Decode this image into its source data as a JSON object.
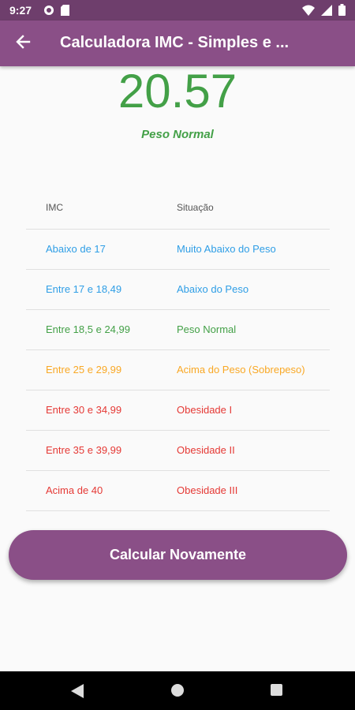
{
  "status_bar": {
    "time": "9:27"
  },
  "app_bar": {
    "title": "Calculadora IMC - Simples e ..."
  },
  "result": {
    "value": "20.57",
    "label": "Peso Normal"
  },
  "table": {
    "headers": [
      "IMC",
      "Situação"
    ],
    "rows": [
      {
        "imc": "Abaixo de 17",
        "situacao": "Muito Abaixo do Peso",
        "color": "#2f9ee6"
      },
      {
        "imc": "Entre 17 e 18,49",
        "situacao": "Abaixo do Peso",
        "color": "#2f9ee6"
      },
      {
        "imc": "Entre 18,5 e 24,99",
        "situacao": "Peso Normal",
        "color": "#43a047"
      },
      {
        "imc": "Entre 25 e 29,99",
        "situacao": "Acima do Peso (Sobrepeso)",
        "color": "#f9a825"
      },
      {
        "imc": "Entre 30 e 34,99",
        "situacao": "Obesidade I",
        "color": "#e53935"
      },
      {
        "imc": "Entre 35 e 39,99",
        "situacao": "Obesidade II",
        "color": "#e53935"
      },
      {
        "imc": "Acima de 40",
        "situacao": "Obesidade III",
        "color": "#e53935"
      }
    ]
  },
  "button": {
    "label": "Calcular Novamente"
  },
  "colors": {
    "primary": "#8a4f87",
    "status_bar": "#6e3e6c",
    "normal": "#43a047"
  }
}
